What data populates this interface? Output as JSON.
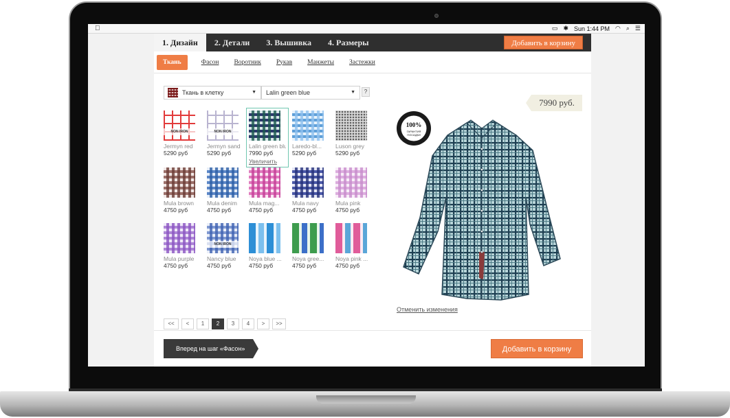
{
  "menubar": {
    "time": "Sun 1:44 PM"
  },
  "steps": [
    {
      "label": "1. Дизайн",
      "active": true
    },
    {
      "label": "2. Детали",
      "active": false
    },
    {
      "label": "3. Вышивка",
      "active": false
    },
    {
      "label": "4. Размеры",
      "active": false
    }
  ],
  "header": {
    "cart_label": "Добавить в корзину"
  },
  "subtabs": [
    {
      "label": "Ткань",
      "active": true
    },
    {
      "label": "Фасон",
      "active": false
    },
    {
      "label": "Воротник",
      "active": false
    },
    {
      "label": "Рукав",
      "active": false
    },
    {
      "label": "Манжеты",
      "active": false
    },
    {
      "label": "Застежки",
      "active": false
    }
  ],
  "filters": {
    "type_value": "Ткань в клетку",
    "fabric_value": "Lalin green blue",
    "help_label": "?"
  },
  "fabrics": [
    {
      "name": "Jermyn red",
      "price": "5290 руб",
      "colors": [
        "#e23a3a",
        "#ffffff",
        "#f2f2f2"
      ],
      "style": "windowpane",
      "tag": "NON IRON"
    },
    {
      "name": "Jermyn sand",
      "price": "5290 руб",
      "colors": [
        "#b9b4d0",
        "#ffffff",
        "#f4f4f8"
      ],
      "style": "windowpane",
      "tag": "NON IRON"
    },
    {
      "name": "Lalin green blue",
      "price": "7990 руб",
      "colors": [
        "#1b5a4e",
        "#d8e8e8",
        "#2d3a6b"
      ],
      "style": "gingham",
      "tag": "",
      "selected": true,
      "zoom": "Увеличить"
    },
    {
      "name": "Laredo-bl...",
      "price": "5290 руб",
      "colors": [
        "#8fc1ee",
        "#e8f3fc",
        "#5f9fd8"
      ],
      "style": "gingham",
      "tag": ""
    },
    {
      "name": "Luson grey",
      "price": "5290 руб",
      "colors": [
        "#5a5a5a",
        "#d6d6d6",
        "#999999"
      ],
      "style": "dots",
      "tag": ""
    },
    {
      "name": "Mula brown",
      "price": "4750 руб",
      "colors": [
        "#6b3b35",
        "#f1e8e6",
        "#9b6f69"
      ],
      "style": "gingham",
      "tag": ""
    },
    {
      "name": "Mula denim",
      "price": "4750 руб",
      "colors": [
        "#2c5ea6",
        "#e7eef8",
        "#5b86c6"
      ],
      "style": "gingham",
      "tag": ""
    },
    {
      "name": "Mula mag...",
      "price": "4750 руб",
      "colors": [
        "#c63e98",
        "#fbe9f4",
        "#e07bbd"
      ],
      "style": "gingham",
      "tag": ""
    },
    {
      "name": "Mula navy",
      "price": "4750 руб",
      "colors": [
        "#24307a",
        "#e6e8f5",
        "#4a58a8"
      ],
      "style": "gingham",
      "tag": ""
    },
    {
      "name": "Mula pink",
      "price": "4750 руб",
      "colors": [
        "#c88ccc",
        "#f8eef8",
        "#dcaede"
      ],
      "style": "gingham",
      "tag": ""
    },
    {
      "name": "Mula purple",
      "price": "4750 руб",
      "colors": [
        "#8b55c2",
        "#efe8f8",
        "#ad86d6"
      ],
      "style": "gingham",
      "tag": ""
    },
    {
      "name": "Nancy blue",
      "price": "4750 руб",
      "colors": [
        "#3f62b2",
        "#e9eef8",
        "#7f98d0"
      ],
      "style": "gingham",
      "tag": "NON IRON"
    },
    {
      "name": "Noya blue ...",
      "price": "4750 руб",
      "colors": [
        "#2d8fd6",
        "#e8f4fc",
        "#7cc0ee"
      ],
      "style": "madras",
      "tag": ""
    },
    {
      "name": "Noya gree...",
      "price": "4750 руб",
      "colors": [
        "#3e9c4e",
        "#e8f5ea",
        "#3c6fc8"
      ],
      "style": "madras",
      "tag": ""
    },
    {
      "name": "Noya pink ...",
      "price": "4750 руб",
      "colors": [
        "#e05c9a",
        "#fbeaf2",
        "#5aa6d8"
      ],
      "style": "madras",
      "tag": ""
    }
  ],
  "pagination": {
    "first": "<<",
    "prev": "<",
    "pages": [
      "1",
      "2",
      "3",
      "4"
    ],
    "current": "2",
    "next": ">",
    "last": ">>"
  },
  "preview": {
    "price": "7990 руб.",
    "seal_text": "100% ГАРАНТИЯ ПОСАДКИ",
    "undo_label": "Отменить изменения"
  },
  "footer": {
    "next_label": "Вперед на шаг «Фасон»",
    "cart_label": "Добавить в корзину"
  },
  "colors": {
    "accent": "#ef7d45",
    "dark_bar": "#2f2f2f",
    "selected_border": "#6fc6b0"
  }
}
